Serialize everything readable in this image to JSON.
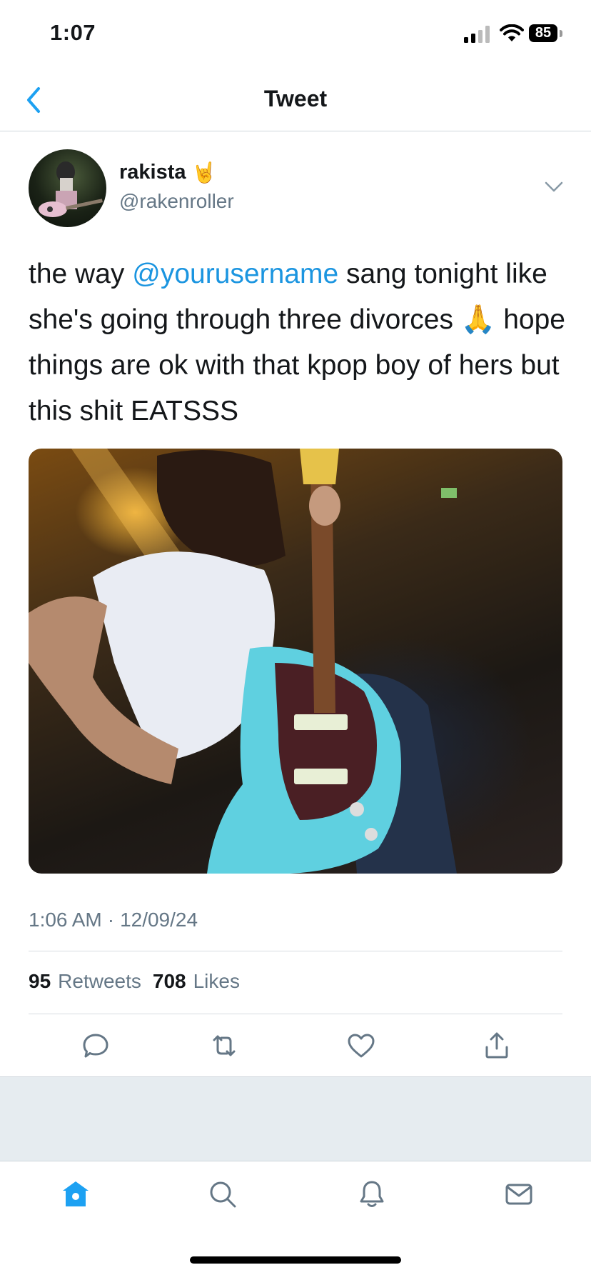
{
  "status_bar": {
    "time": "1:07",
    "battery": "85"
  },
  "header": {
    "title": "Tweet"
  },
  "author": {
    "name": "rakista",
    "name_emoji": "🤘",
    "handle": "@rakenroller"
  },
  "tweet": {
    "text_before_mention": "the way ",
    "mention": "@yourusername",
    "text_after_mention": " sang tonight like she's going through three divorces 🙏 hope things are ok with that kpop boy of hers but this shit EATSSS",
    "time": "1:06 AM",
    "separator": "·",
    "date": "12/09/24"
  },
  "stats": {
    "retweets_count": "95",
    "retweets_label": "Retweets",
    "likes_count": "708",
    "likes_label": "Likes"
  },
  "icons": {
    "back": "chevron-left-icon",
    "more": "chevron-down-icon",
    "reply": "reply-icon",
    "retweet": "retweet-icon",
    "like": "heart-icon",
    "share": "share-icon",
    "home": "home-icon",
    "search": "search-icon",
    "notifications": "bell-icon",
    "messages": "mail-icon"
  },
  "colors": {
    "accent": "#1da1f2",
    "mention": "#1b95e0",
    "secondary_text": "#657786",
    "band": "#e6ecf0"
  }
}
